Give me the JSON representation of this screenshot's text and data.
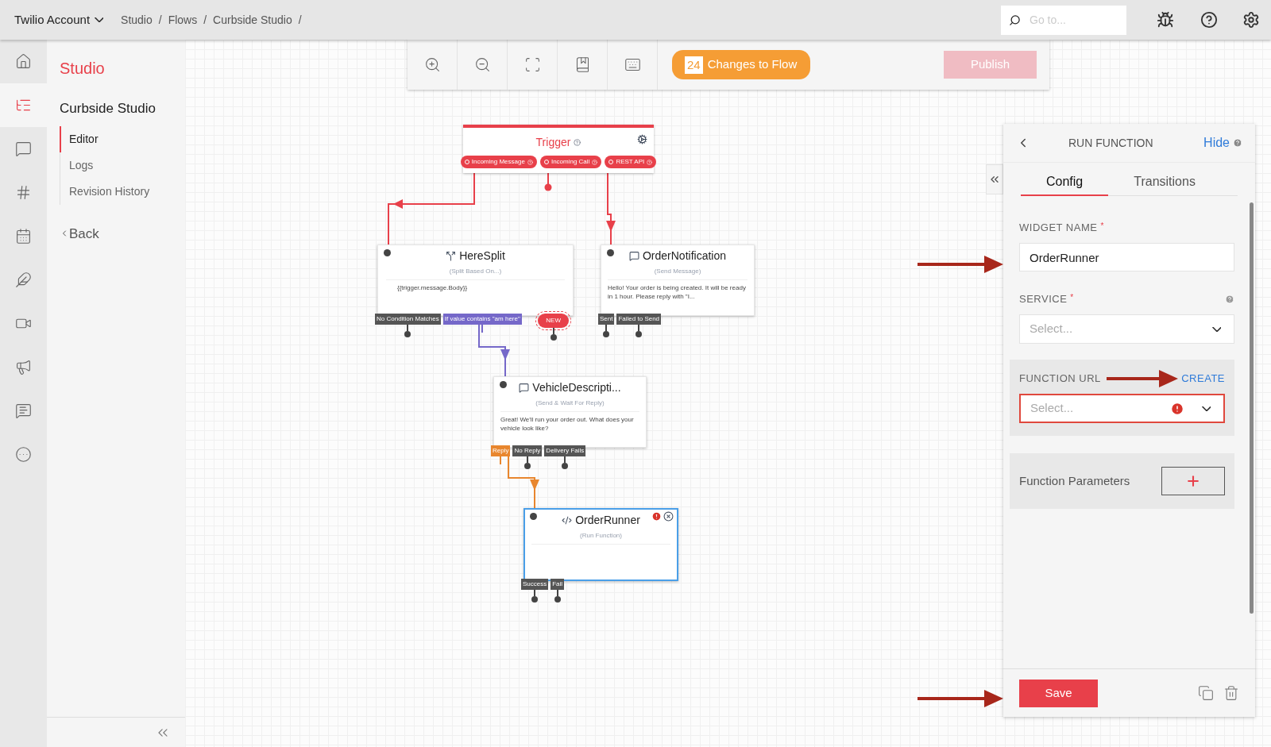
{
  "top_bar": {
    "account": "Twilio Account",
    "breadcrumbs": [
      "Studio",
      "Flows",
      "Curbside Studio"
    ],
    "separator": "/",
    "search": {
      "placeholder": "Go to..."
    }
  },
  "nav_rail": [
    {
      "kind": "home",
      "selected": false
    },
    {
      "kind": "flow",
      "selected": true
    },
    {
      "kind": "chat",
      "selected": false
    },
    {
      "kind": "hash",
      "selected": false
    },
    {
      "kind": "calendar",
      "selected": false
    },
    {
      "kind": "feather",
      "selected": false
    },
    {
      "kind": "video",
      "selected": false
    },
    {
      "kind": "megaphone",
      "selected": false
    },
    {
      "kind": "chat-text",
      "selected": false
    },
    {
      "kind": "more",
      "selected": false
    }
  ],
  "sidebar": {
    "title": "Studio",
    "flow_name": "Curbside Studio",
    "items": [
      {
        "label": "Editor",
        "selected": true
      },
      {
        "label": "Logs",
        "selected": false
      },
      {
        "label": "Revision History",
        "selected": false
      }
    ],
    "back": "Back"
  },
  "toolbar": {
    "changes_count": "24",
    "changes_label": "Changes to Flow",
    "publish": {
      "label": "Publish",
      "disabled": true
    }
  },
  "flow": {
    "nodes": [
      {
        "kind": "trigger",
        "title": "Trigger",
        "triggers": [
          "Incoming Message",
          "Incoming Call",
          "REST API"
        ]
      },
      {
        "kind": "split",
        "title": "HereSplit",
        "subtitle": "(Split Based On...)",
        "body": "{{trigger.message.Body}}",
        "selected": false,
        "transitions": [
          {
            "kind": "port",
            "label": "No Condition Matches",
            "color": "#555555",
            "connected": false
          },
          {
            "kind": "port",
            "label": "If value contains \"am here\"",
            "color": "#7568c9",
            "connected": true
          },
          {
            "kind": "new",
            "label": "NEW",
            "color": "#e8404a",
            "connected": false
          }
        ]
      },
      {
        "kind": "message",
        "title": "OrderNotification",
        "subtitle": "(Send Message)",
        "body": "Hello! Your order is being created. It will be ready in 1 hour. Please reply with \"I...",
        "selected": false,
        "transitions": [
          {
            "kind": "port",
            "label": "Sent",
            "color": "#555555",
            "connected": false
          },
          {
            "kind": "port",
            "label": "Failed to Send",
            "color": "#555555",
            "connected": false
          }
        ]
      },
      {
        "kind": "message",
        "title": "VehicleDescripti...",
        "subtitle": "(Send & Wait For Reply)",
        "body": "Great! We'll run your order out. What does your vehicle look like?",
        "selected": false,
        "transitions": [
          {
            "kind": "port",
            "label": "Reply",
            "color": "#e8862e",
            "connected": true
          },
          {
            "kind": "port",
            "label": "No Reply",
            "color": "#555555",
            "connected": false
          },
          {
            "kind": "port",
            "label": "Delivery Fails",
            "color": "#555555",
            "connected": false
          }
        ]
      },
      {
        "kind": "function",
        "title": "OrderRunner",
        "subtitle": "(Run Function)",
        "selected": true,
        "error": true,
        "transitions": [
          {
            "kind": "port",
            "label": "Success",
            "color": "#555555",
            "connected": false
          },
          {
            "kind": "port",
            "label": "Fail",
            "color": "#555555",
            "connected": false
          }
        ]
      }
    ]
  },
  "panel": {
    "title": "RUN FUNCTION",
    "hide": "Hide",
    "tabs": [
      {
        "label": "Config",
        "selected": true
      },
      {
        "label": "Transitions",
        "selected": false
      }
    ],
    "fields": [
      {
        "kind": "text",
        "label": "WIDGET NAME",
        "required_mark": "*",
        "value": "OrderRunner"
      },
      {
        "kind": "select",
        "label": "SERVICE",
        "required_mark": "*",
        "placeholder": "Select...",
        "help": true
      },
      {
        "kind": "select",
        "label": "FUNCTION URL",
        "placeholder": "Select...",
        "action": "CREATE",
        "error": true
      }
    ],
    "parameters": {
      "label": "Function Parameters"
    },
    "save": "Save"
  }
}
